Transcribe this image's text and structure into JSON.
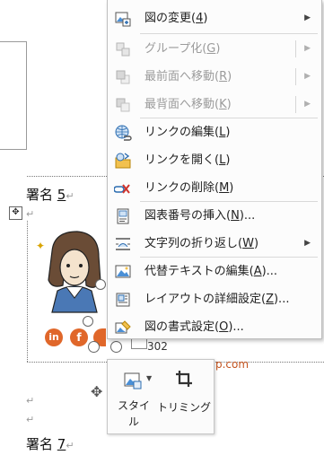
{
  "document": {
    "signature_5": {
      "prefix": "署名 ",
      "number": "5"
    },
    "signature_7": {
      "prefix": "署名 ",
      "number": "7"
    },
    "return_mark": "↵",
    "text_fragment_number": "302",
    "text_fragment_email": "p.com",
    "social_icons": [
      "in",
      "f"
    ]
  },
  "context_menu": {
    "items": [
      {
        "label": "図の変更(",
        "key": "4",
        "suffix": ")",
        "icon": "change-picture-icon",
        "disabled": false,
        "submenu": true
      },
      {
        "label": "グループ化(",
        "key": "G",
        "suffix": ")",
        "icon": "group-icon",
        "disabled": true,
        "submenu": true
      },
      {
        "label": "最前面へ移動(",
        "key": "R",
        "suffix": ")",
        "icon": "bring-to-front-icon",
        "disabled": true,
        "submenu": true
      },
      {
        "label": "最背面へ移動(",
        "key": "K",
        "suffix": ")",
        "icon": "send-to-back-icon",
        "disabled": true,
        "submenu": true
      },
      {
        "label": "リンクの編集(",
        "key": "L",
        "suffix": ")",
        "icon": "edit-link-icon",
        "disabled": false,
        "submenu": false
      },
      {
        "label": "リンクを開く(",
        "key": "L",
        "suffix": ")",
        "icon": "open-link-icon",
        "disabled": false,
        "submenu": false
      },
      {
        "label": "リンクの削除(",
        "key": "M",
        "suffix": ")",
        "icon": "remove-link-icon",
        "disabled": false,
        "submenu": false
      },
      {
        "label": "図表番号の挿入(",
        "key": "N",
        "suffix": ")...",
        "icon": "insert-caption-icon",
        "disabled": false,
        "submenu": false
      },
      {
        "label": "文字列の折り返し(",
        "key": "W",
        "suffix": ")",
        "icon": "wrap-text-icon",
        "disabled": false,
        "submenu": true
      },
      {
        "label": "代替テキストの編集(",
        "key": "A",
        "suffix": ")...",
        "icon": "alt-text-icon",
        "disabled": false,
        "submenu": false
      },
      {
        "label": "レイアウトの詳細設定(",
        "key": "Z",
        "suffix": ")...",
        "icon": "layout-settings-icon",
        "disabled": false,
        "submenu": false
      },
      {
        "label": "図の書式設定(",
        "key": "O",
        "suffix": ")...",
        "icon": "format-picture-icon",
        "disabled": false,
        "submenu": false
      }
    ]
  },
  "mini_toolbar": {
    "style_label_line1": "スタイ",
    "style_label_line2": "ル",
    "trim_label": "トリミング"
  },
  "colors": {
    "accent_orange": "#e0672a",
    "disabled_text": "#9b9b9b"
  }
}
